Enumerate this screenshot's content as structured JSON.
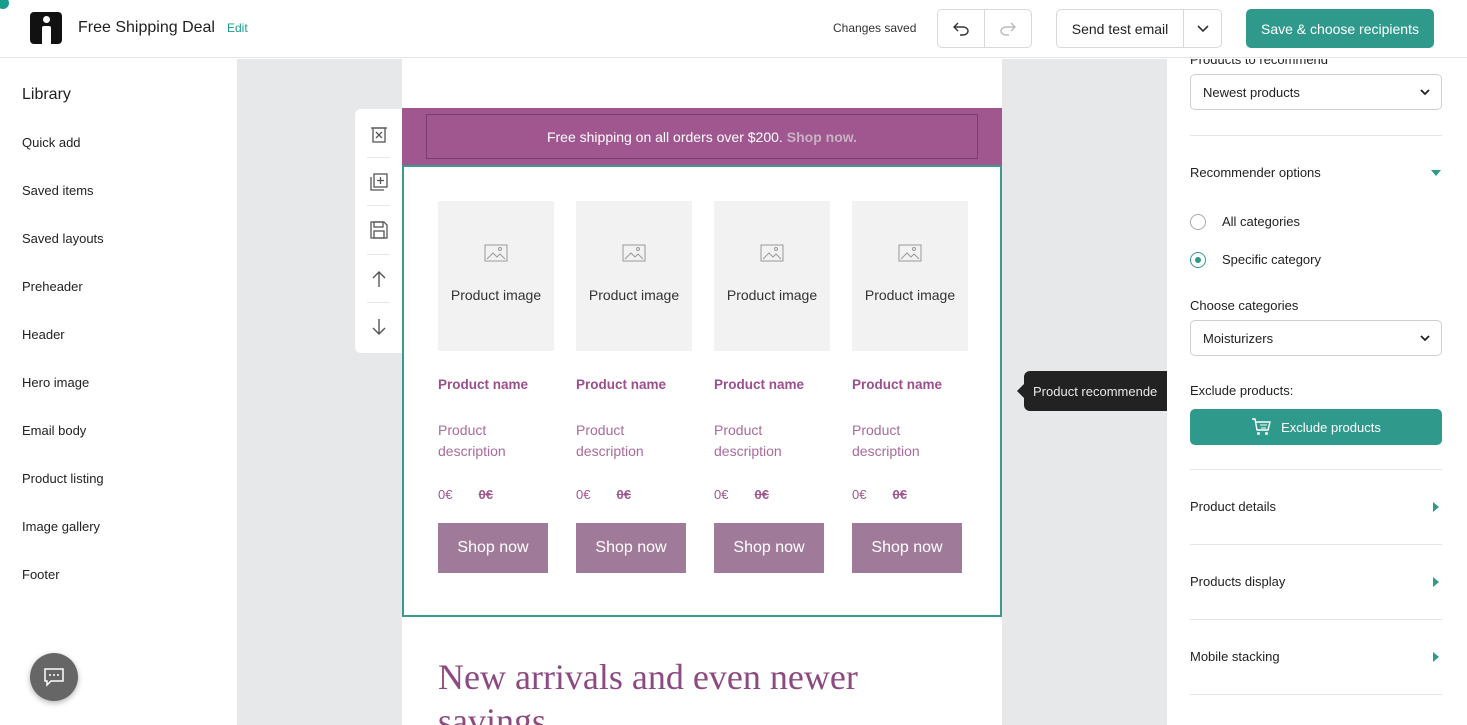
{
  "app": {
    "title": "Free Shipping Deal",
    "edit_label": "Edit",
    "status": "Changes saved",
    "send_test_label": "Send test email",
    "save_label": "Save & choose recipients"
  },
  "library": {
    "title": "Library",
    "items": [
      "Quick add",
      "Saved items",
      "Saved layouts",
      "Preheader",
      "Header",
      "Hero image",
      "Email body",
      "Product listing",
      "Image gallery",
      "Footer"
    ]
  },
  "email": {
    "banner_text": "Free shipping on all orders over $200.",
    "banner_link": "Shop now.",
    "products": [
      {
        "image_label": "Product image",
        "name": "Product name",
        "description": "Product description",
        "price": "0€",
        "old_price": "0€",
        "cta": "Shop now"
      },
      {
        "image_label": "Product image",
        "name": "Product name",
        "description": "Product description",
        "price": "0€",
        "old_price": "0€",
        "cta": "Shop now"
      },
      {
        "image_label": "Product image",
        "name": "Product name",
        "description": "Product description",
        "price": "0€",
        "old_price": "0€",
        "cta": "Shop now"
      },
      {
        "image_label": "Product image",
        "name": "Product name",
        "description": "Product description",
        "price": "0€",
        "old_price": "0€",
        "cta": "Shop now"
      }
    ],
    "heading_line1": "New arrivals and even newer",
    "heading_line2": "savings"
  },
  "tooltip": "Product recommende",
  "panel": {
    "products_to_recommend_label": "Products to recommend",
    "products_to_recommend_value": "Newest products",
    "recommender_options": "Recommender options",
    "radio_all": "All categories",
    "radio_specific": "Specific category",
    "choose_categories_label": "Choose categories",
    "choose_categories_value": "Moisturizers",
    "exclude_label": "Exclude products:",
    "exclude_button": "Exclude products",
    "sections": [
      "Product details",
      "Products display",
      "Mobile stacking"
    ]
  },
  "colors": {
    "accent": "#2f9a8c",
    "brand_purple": "#a0568f",
    "button_purple": "#a07b99"
  }
}
